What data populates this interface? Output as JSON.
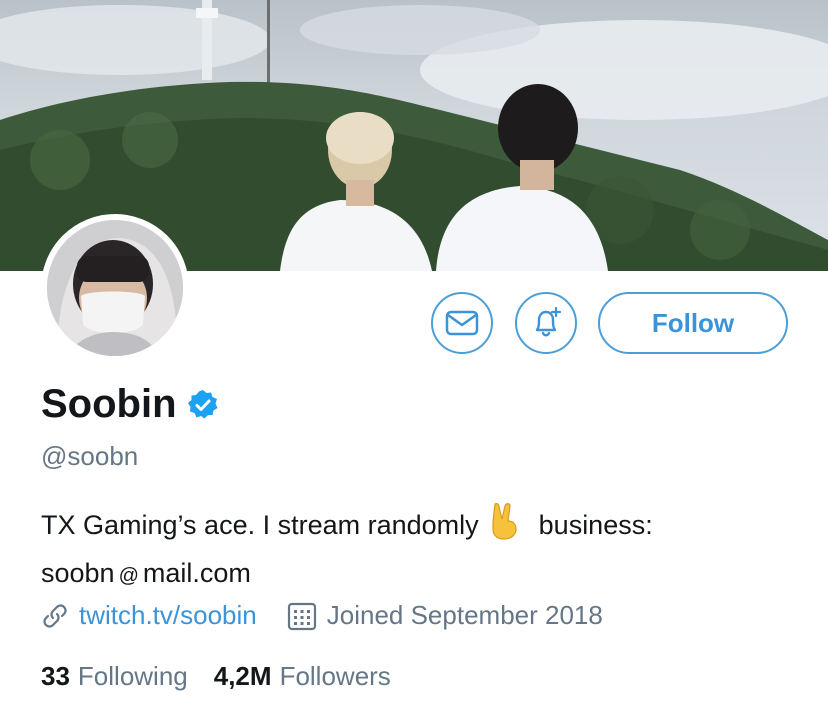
{
  "profile": {
    "name": "Soobin",
    "handle": "@soobn",
    "bio_line1": "TX Gaming’s ace. I stream randomly",
    "bio_line1_after": "business:",
    "bio_email_user": "soobn",
    "bio_email_at": "@",
    "bio_email_domain": "mail.com",
    "link_text": "twitch.tv/soobin",
    "joined": "Joined September 2018",
    "following_count": "33",
    "following_label": "Following",
    "followers_count": "4,2M",
    "followers_label": "Followers"
  },
  "actions": {
    "message_icon": "envelope-icon",
    "notify_icon": "bell-plus-icon",
    "follow_label": "Follow"
  },
  "icons": {
    "verified": "verified-badge-icon",
    "link": "link-icon",
    "calendar": "calendar-icon",
    "emoji": "victory-hand-emoji"
  },
  "colors": {
    "accent": "#3b94d9",
    "verified": "#1da1f2",
    "secondary_text": "#657786",
    "primary_text": "#14171a"
  }
}
